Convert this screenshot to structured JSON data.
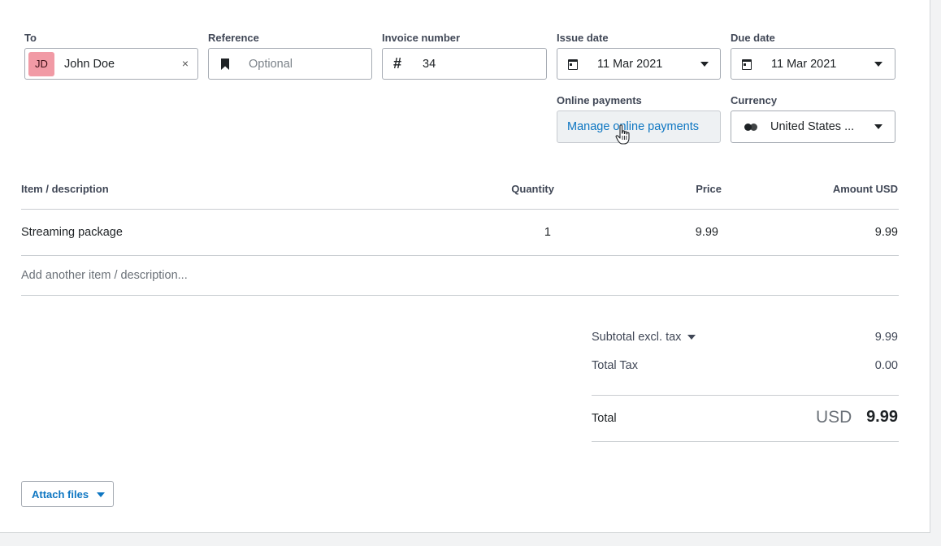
{
  "invoice": {
    "to_label": "To",
    "to_initials": "JD",
    "to_name": "John Doe",
    "to_clear_icon": "×",
    "reference_label": "Reference",
    "reference_placeholder": "Optional",
    "invoice_number_label": "Invoice number",
    "invoice_number_icon": "#",
    "invoice_number": "34",
    "issue_date_label": "Issue date",
    "issue_date": "11 Mar 2021",
    "due_date_label": "Due date",
    "due_date": "11 Mar 2021",
    "online_payments_label": "Online payments",
    "manage_payments_button": "Manage online payments",
    "currency_label": "Currency",
    "currency_value": "United States ..."
  },
  "table": {
    "headers": [
      "Item / description",
      "Quantity",
      "Price",
      "Amount USD"
    ],
    "rows": [
      {
        "item": "Streaming package",
        "quantity": "1",
        "price": "9.99",
        "amount": "9.99"
      }
    ],
    "add_placeholder": "Add another item / description..."
  },
  "totals": {
    "subtotal_label": "Subtotal excl. tax",
    "subtotal": "9.99",
    "tax_label": "Total Tax",
    "tax": "0.00",
    "total_label": "Total",
    "currency": "USD",
    "total": "9.99"
  },
  "attach_button": "Attach files",
  "icons": [
    "close-icon",
    "bookmark-icon",
    "hash-icon",
    "calendar-icon",
    "chevron-down-icon",
    "currency-flag-icon",
    "hand-pointer-cursor"
  ],
  "colors": {
    "accent_link": "#0d76c2",
    "avatar_bg": "#f19aa5"
  }
}
